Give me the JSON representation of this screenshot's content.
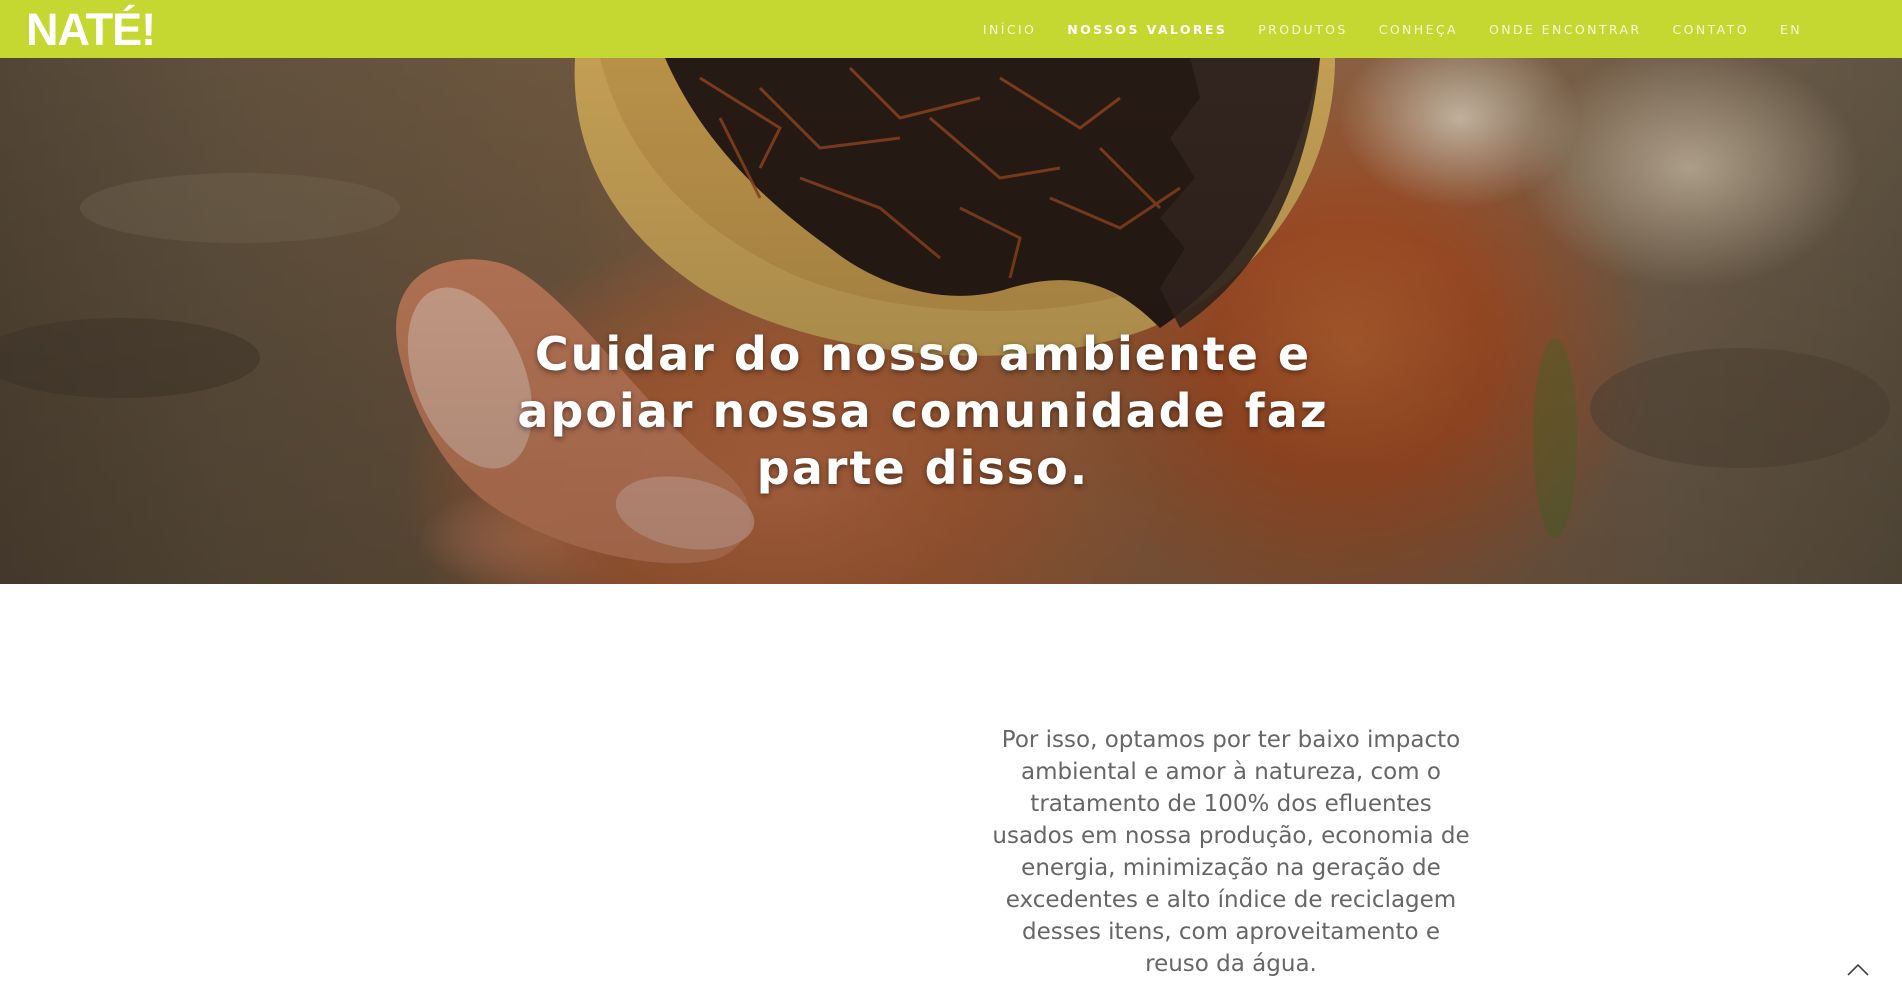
{
  "header": {
    "logo_text": "NATÉ!",
    "brand_color": "#c5d832",
    "nav": [
      {
        "label": "INÍCIO",
        "active": false
      },
      {
        "label": "NOSSOS VALORES",
        "active": true
      },
      {
        "label": "PRODUTOS",
        "active": false
      },
      {
        "label": "CONHEÇA",
        "active": false
      },
      {
        "label": "ONDE ENCONTRAR",
        "active": false
      },
      {
        "label": "CONTATO",
        "active": false
      },
      {
        "label": "EN",
        "active": false
      }
    ]
  },
  "hero": {
    "image_subject": "hand-holding-seedling-pot",
    "headline": "Cuidar do nosso ambiente e apoiar nossa comunidade faz parte disso."
  },
  "content": {
    "paragraph": "Por isso, optamos por ter baixo impacto ambiental e amor à natureza, com o tratamento de 100% dos efluentes usados em nossa produção, economia de energia, minimização na geração de excedentes e alto índice de reciclagem desses itens, com aproveitamento e reuso da água."
  },
  "back_to_top": {
    "icon": "chevron-up-icon"
  }
}
